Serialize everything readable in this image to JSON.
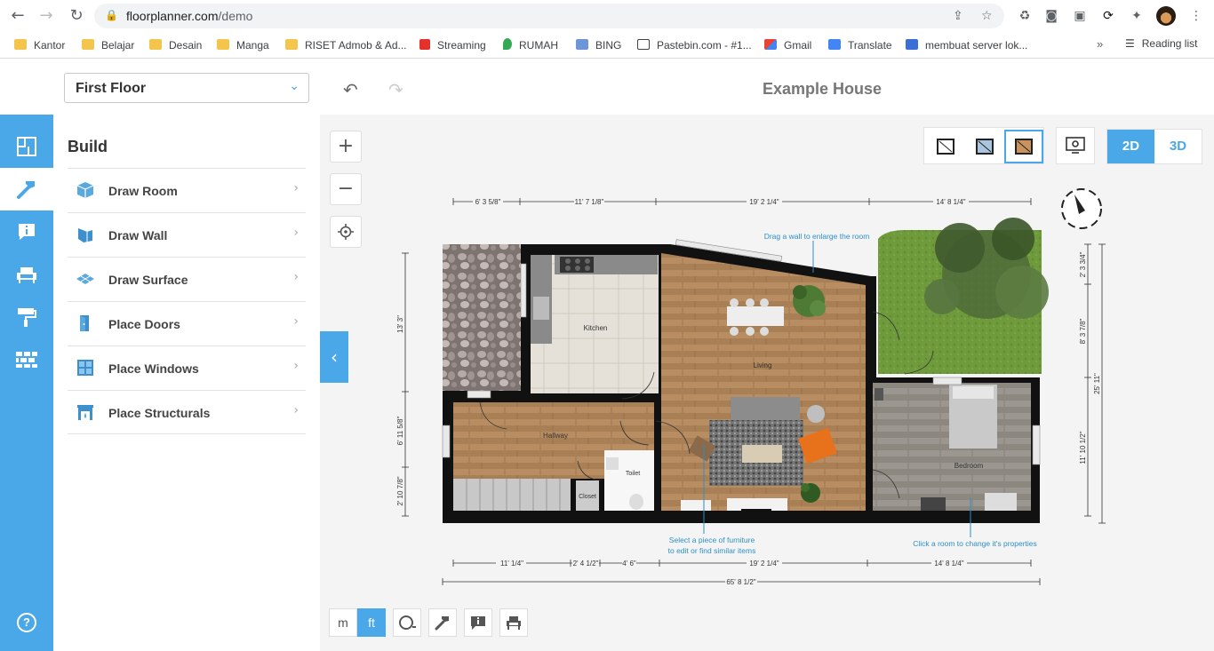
{
  "browser": {
    "url_host": "floorplanner.com",
    "url_path": "/demo",
    "bookmarks": [
      {
        "label": "Kantor",
        "icon": "folder-icon"
      },
      {
        "label": "Belajar",
        "icon": "folder-icon"
      },
      {
        "label": "Desain",
        "icon": "folder-icon"
      },
      {
        "label": "Manga",
        "icon": "folder-icon"
      },
      {
        "label": "RISET Admob & Ad...",
        "icon": "folder-icon"
      },
      {
        "label": "Streaming",
        "icon": "swiss-cross-icon"
      },
      {
        "label": "RUMAH",
        "icon": "maps-pin-icon"
      },
      {
        "label": "BING",
        "icon": "bing-icon"
      },
      {
        "label": "Pastebin.com - #1...",
        "icon": "pastebin-icon"
      },
      {
        "label": "Gmail",
        "icon": "gmail-icon"
      },
      {
        "label": "Translate",
        "icon": "translate-icon"
      },
      {
        "label": "membuat server lok...",
        "icon": "site-icon"
      }
    ],
    "more": "»",
    "reading_list": "Reading list"
  },
  "header": {
    "floor_select": "First Floor",
    "project_title": "Example House"
  },
  "build": {
    "title": "Build",
    "items": [
      {
        "label": "Draw Room",
        "icon": "room-cube-icon"
      },
      {
        "label": "Draw Wall",
        "icon": "wall-icon"
      },
      {
        "label": "Draw Surface",
        "icon": "surface-icon"
      },
      {
        "label": "Place Doors",
        "icon": "door-icon"
      },
      {
        "label": "Place Windows",
        "icon": "window-icon"
      },
      {
        "label": "Place Structurals",
        "icon": "fireplace-icon"
      }
    ]
  },
  "toolbar": {
    "view_2d": "2D",
    "view_3d": "3D",
    "unit_m": "m",
    "unit_ft": "ft",
    "active_unit": "ft",
    "active_view": "2D"
  },
  "plan": {
    "rooms": {
      "kitchen": "Kitchen",
      "living": "Living",
      "hallway": "Hallway",
      "toilet": "Toilet",
      "closet": "Closet",
      "bedroom": "Bedroom"
    },
    "dims_top": [
      "6' 3 5/8\"",
      "11' 7 1/8\"",
      "19' 2 1/4\"",
      "14' 8 1/4\""
    ],
    "dims_bottom": [
      "11' 1/4\"",
      "2' 4 1/2\"",
      "4' 6\"",
      "19' 2 1/4\"",
      "14' 8 1/4\""
    ],
    "dim_total": "65' 8 1/2\"",
    "dims_left": [
      "13' 3\"",
      "6' 11 5/8\"",
      "2' 10 7/8\""
    ],
    "dims_right": [
      "2' 3 3/4\"",
      "8' 3 7/8\"",
      "11' 10 1/2\"",
      "25' 11\""
    ],
    "hints": {
      "drag_wall": "Drag a wall to enlarge the room",
      "select_furniture_1": "Select a piece of furniture",
      "select_furniture_2": "to edit or find similar items",
      "click_room": "Click a room to change it's properties"
    }
  },
  "colors": {
    "accent": "#4aa8e8",
    "wall": "#111111",
    "wood": "#b48a5e",
    "hint": "#2b8fc9"
  }
}
